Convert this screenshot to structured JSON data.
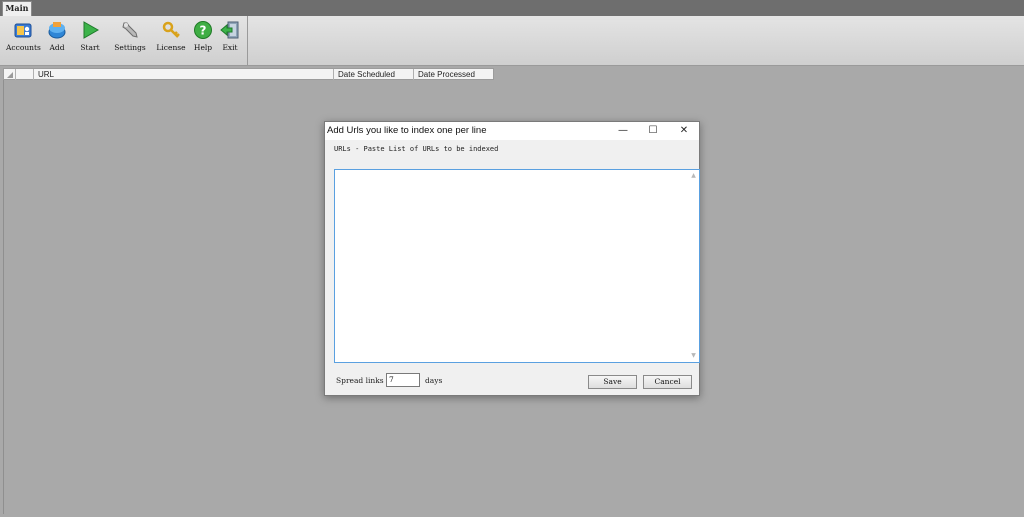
{
  "tab": "Main",
  "toolbar": {
    "accounts": "Accounts",
    "add": "Add",
    "start": "Start",
    "settings": "Settings",
    "license": "License",
    "help": "Help",
    "exit": "Exit"
  },
  "grid": {
    "columns": [
      "URL",
      "Date Scheduled",
      "Date Processed"
    ]
  },
  "dialog": {
    "title": "Add Urls you like to index one per line",
    "minimize": "—",
    "maximize": "☐",
    "close": "✕",
    "urls_label": "URLs - Paste List of URLs to be indexed",
    "urls_value": "",
    "spread_label": "Spread links",
    "spread_value": "7",
    "days_label": "days",
    "save": "Save",
    "cancel": "Cancel"
  }
}
